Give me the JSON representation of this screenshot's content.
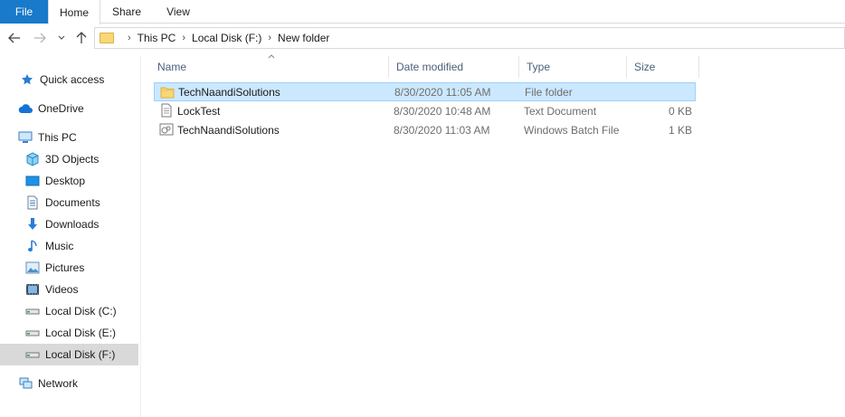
{
  "ribbon": {
    "tabs": [
      {
        "label": "File"
      },
      {
        "label": "Home"
      },
      {
        "label": "Share"
      },
      {
        "label": "View"
      }
    ]
  },
  "address": {
    "crumbs": [
      "This PC",
      "Local Disk (F:)",
      "New folder"
    ]
  },
  "nav": {
    "items": [
      {
        "label": "Quick access",
        "icon": "star-icon"
      },
      {
        "label": "OneDrive",
        "icon": "cloud-icon"
      },
      {
        "label": "This PC",
        "icon": "monitor-icon"
      },
      {
        "label": "3D Objects",
        "icon": "cube-icon"
      },
      {
        "label": "Desktop",
        "icon": "desktop-icon"
      },
      {
        "label": "Documents",
        "icon": "document-icon"
      },
      {
        "label": "Downloads",
        "icon": "download-icon"
      },
      {
        "label": "Music",
        "icon": "music-icon"
      },
      {
        "label": "Pictures",
        "icon": "picture-icon"
      },
      {
        "label": "Videos",
        "icon": "video-icon"
      },
      {
        "label": "Local Disk (C:)",
        "icon": "drive-icon"
      },
      {
        "label": "Local Disk (E:)",
        "icon": "drive-icon"
      },
      {
        "label": "Local Disk (F:)",
        "icon": "drive-icon",
        "selected": true
      },
      {
        "label": "Network",
        "icon": "network-icon"
      }
    ]
  },
  "columns": {
    "name": "Name",
    "date": "Date modified",
    "type": "Type",
    "size": "Size"
  },
  "files": [
    {
      "name": "TechNaandiSolutions",
      "date": "8/30/2020 11:05 AM",
      "type": "File folder",
      "size": "",
      "icon": "folder-icon",
      "selected": true
    },
    {
      "name": "LockTest",
      "date": "8/30/2020 10:48 AM",
      "type": "Text Document",
      "size": "0 KB",
      "icon": "text-file-icon"
    },
    {
      "name": "TechNaandiSolutions",
      "date": "8/30/2020 11:03 AM",
      "type": "Windows Batch File",
      "size": "1 KB",
      "icon": "batch-file-icon"
    }
  ],
  "colors": {
    "accent": "#1979ca",
    "selection": "#cce8ff",
    "selection_border": "#99d1ff",
    "nav_selected": "#d9d9d9"
  }
}
